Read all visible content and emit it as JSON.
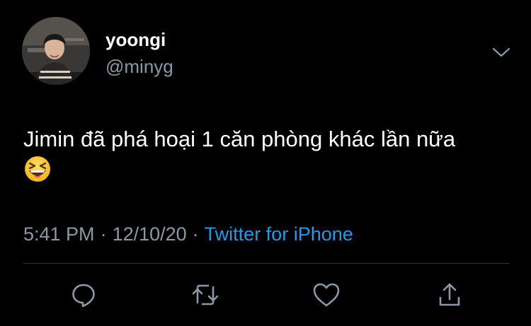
{
  "tweet": {
    "author": {
      "display_name": "yoongi",
      "handle": "@minyg"
    },
    "text": "Jimin đã phá hoại 1 căn phòng khác lần nữa",
    "emoji": "laughing-face",
    "meta": {
      "time": "5:41 PM",
      "separator": "·",
      "date": "12/10/20",
      "source": "Twitter for iPhone"
    }
  },
  "actions": [
    "reply-icon",
    "retweet-icon",
    "like-icon",
    "share-icon"
  ],
  "colors": {
    "background": "#000000",
    "text": "#ffffff",
    "secondary": "#8b98a5",
    "accent": "#1d9bf0",
    "divider": "#2f3336"
  }
}
